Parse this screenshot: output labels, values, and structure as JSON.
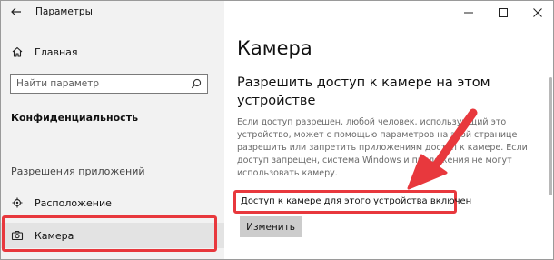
{
  "window": {
    "title": "Параметры"
  },
  "sidebar": {
    "home_label": "Главная",
    "search": {
      "placeholder": "Найти параметр"
    },
    "section_title": "Конфиденциальность",
    "group_title": "Разрешения приложений",
    "items": [
      {
        "label": "Расположение",
        "icon": "location-icon"
      },
      {
        "label": "Камера",
        "icon": "camera-icon",
        "selected": true
      }
    ]
  },
  "main": {
    "title": "Камера",
    "subheading": "Разрешить доступ к камере на этом устройстве",
    "description": "Если доступ разрешен, любой человек, использующий это устройство, может с помощью параметров на этой странице разрешить или запретить приложениям доступ к камере. Если доступ запрещен, система Windows и приложения не могут использовать камеру.",
    "status_text": "Доступ к камере для этого устройства включен",
    "change_button": "Изменить"
  },
  "colors": {
    "highlight": "#e8383d",
    "sidebar_bg": "#f2f2f2",
    "button_bg": "#cccccc"
  }
}
